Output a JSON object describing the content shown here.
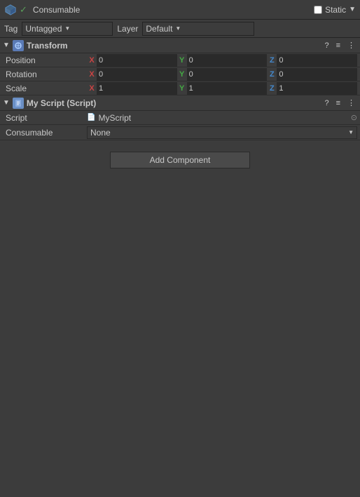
{
  "topBar": {
    "objectName": "Consumable",
    "staticLabel": "Static",
    "staticChecked": false,
    "dropdownArrow": "▼"
  },
  "tagLayer": {
    "tagLabel": "Tag",
    "tagValue": "Untagged",
    "layerLabel": "Layer",
    "layerValue": "Default"
  },
  "transform": {
    "sectionTitle": "Transform",
    "position": {
      "label": "Position",
      "x": "0",
      "y": "0",
      "z": "0"
    },
    "rotation": {
      "label": "Rotation",
      "x": "0",
      "y": "0",
      "z": "0"
    },
    "scale": {
      "label": "Scale",
      "x": "1",
      "y": "1",
      "z": "1"
    }
  },
  "myScript": {
    "sectionTitle": "My Script (Script)",
    "scriptLabel": "Script",
    "scriptValue": "MyScript",
    "consumableLabel": "Consumable",
    "consumableValue": "None"
  },
  "addComponent": {
    "label": "Add Component"
  },
  "icons": {
    "questionMark": "?",
    "settings": "≡",
    "overflow": "⋮",
    "checkmark": "✓"
  }
}
